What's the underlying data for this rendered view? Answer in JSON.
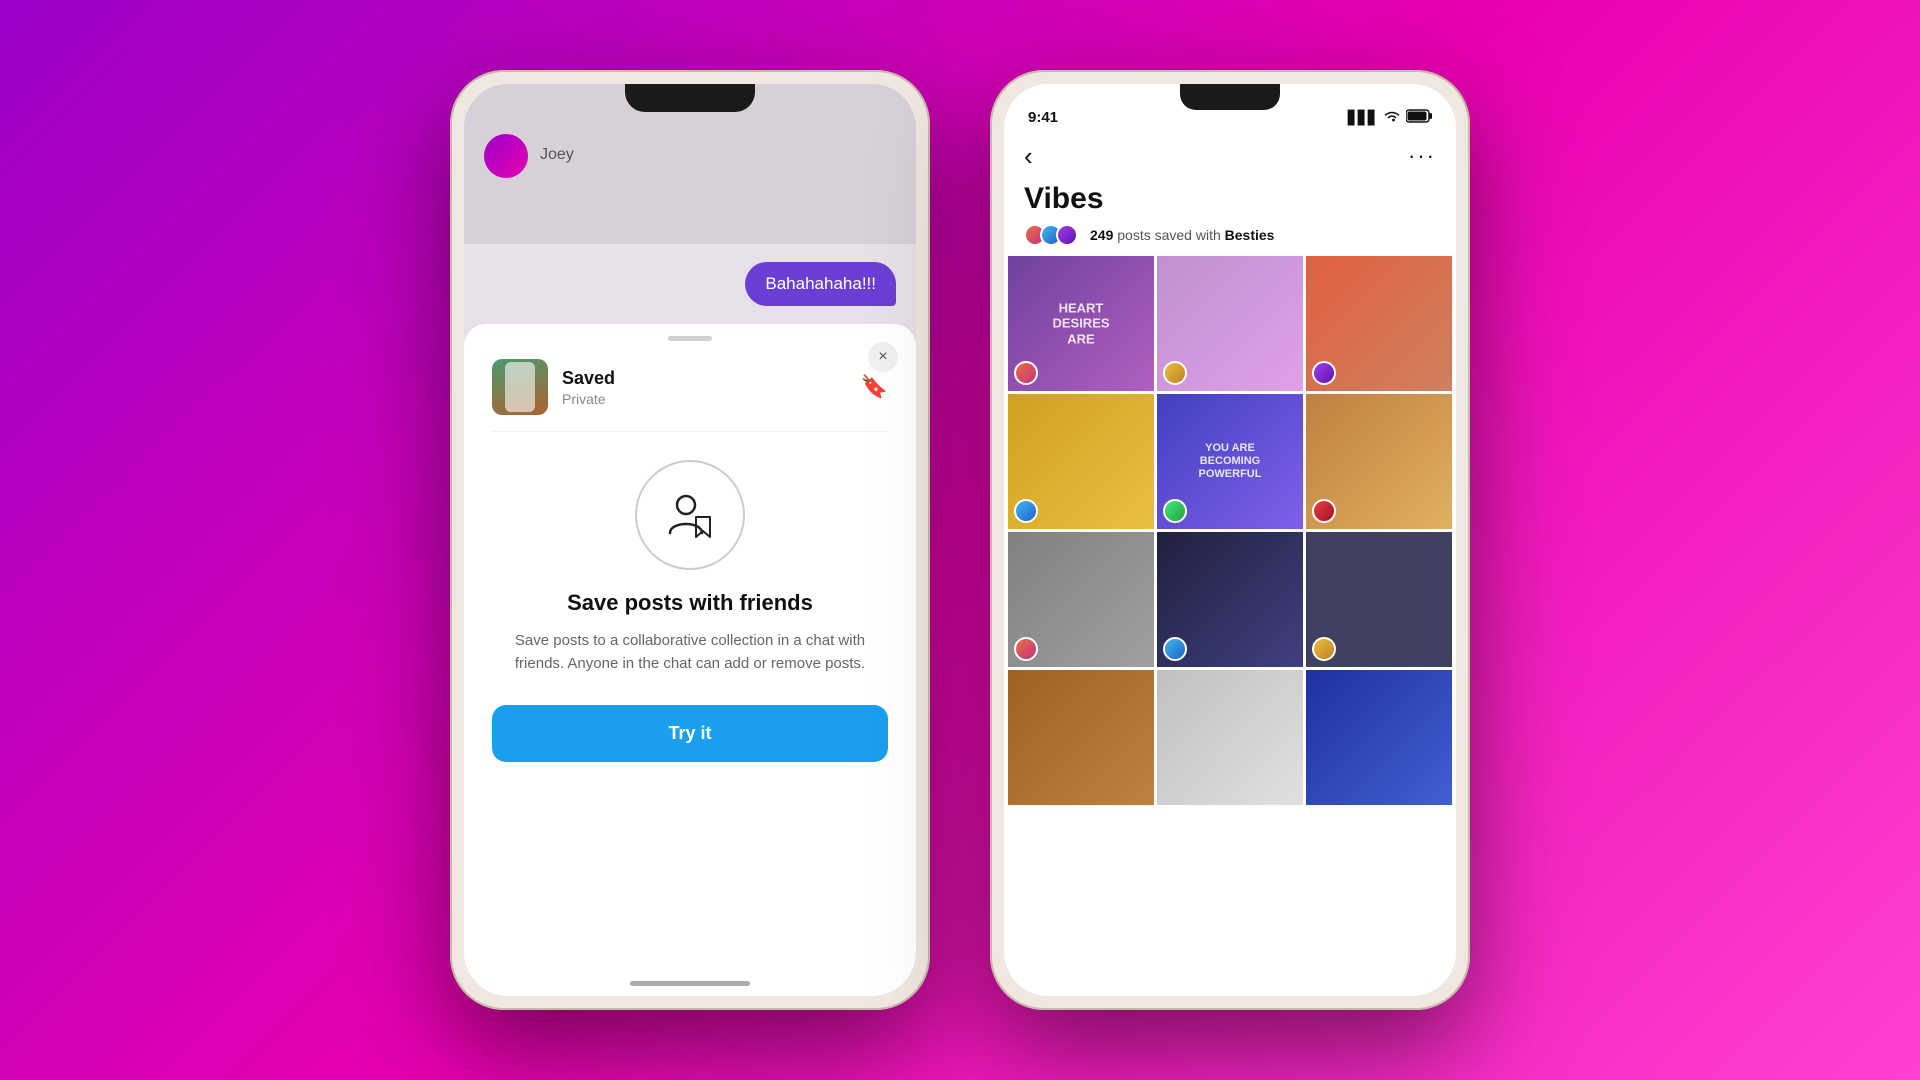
{
  "background": {
    "gradient": "linear-gradient(135deg, #9b00c8 0%, #e800b0 50%, #ff40d0 100%)"
  },
  "left_phone": {
    "chat": {
      "bubble_text": "Bahahahaha!!!",
      "contact_name": "Joey"
    },
    "saved_header": {
      "title": "Saved",
      "subtitle": "Private",
      "bookmark_char": "🔖"
    },
    "modal": {
      "heading": "Save posts with friends",
      "description": "Save posts to a collaborative collection in a chat with friends. Anyone in the chat can add or remove posts.",
      "cta_label": "Try it",
      "close_char": "×"
    }
  },
  "right_phone": {
    "status_bar": {
      "time": "9:41",
      "signal": "▋▋▋",
      "wifi": "WiFi",
      "battery": "🔋"
    },
    "vibes": {
      "title": "Vibes",
      "post_count": "249",
      "posts_label": "posts saved with",
      "group_name": "Besties",
      "back_char": "‹",
      "more_char": "···"
    },
    "grid": [
      {
        "id": "c1",
        "text": "HEART\nDESIRES\nARE",
        "av_class": "av-g1"
      },
      {
        "id": "c2",
        "text": "",
        "av_class": "av-g2"
      },
      {
        "id": "c3",
        "text": "",
        "av_class": "av-g3"
      },
      {
        "id": "c4",
        "text": "",
        "av_class": "av-g4"
      },
      {
        "id": "c5",
        "text": "YOU ARE\nBECOMING\nPOWERFUL",
        "av_class": "av-g5"
      },
      {
        "id": "c6",
        "text": "",
        "av_class": "av-g6"
      },
      {
        "id": "c7",
        "text": "",
        "av_class": "av-g7"
      },
      {
        "id": "c8",
        "text": "",
        "av_class": "av-g8"
      },
      {
        "id": "c9",
        "text": "",
        "av_class": "av-g9"
      },
      {
        "id": "c10",
        "text": "",
        "av_class": "av-g1"
      },
      {
        "id": "c11",
        "text": "",
        "av_class": "av-g2"
      },
      {
        "id": "c12",
        "text": "",
        "av_class": "av-g3"
      }
    ]
  }
}
